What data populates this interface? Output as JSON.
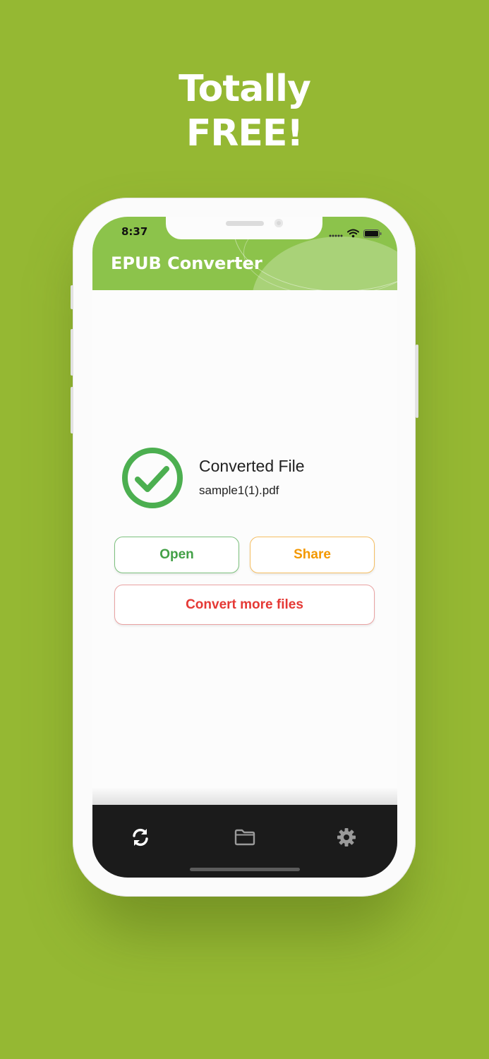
{
  "promo": {
    "line1": "Totally",
    "line2": "FREE!"
  },
  "status_bar": {
    "time": "8:37",
    "icons": [
      "signal-dots-icon",
      "wifi-icon",
      "battery-icon"
    ]
  },
  "header": {
    "title": "EPUB Converter"
  },
  "result": {
    "icon": "check-circle-icon",
    "title": "Converted File",
    "filename": "sample1(1).pdf"
  },
  "actions": {
    "open_label": "Open",
    "share_label": "Share",
    "convert_more_label": "Convert more files"
  },
  "tab_bar": {
    "items": [
      {
        "icon": "refresh-icon",
        "active": true
      },
      {
        "icon": "folder-icon",
        "active": false
      },
      {
        "icon": "gear-icon",
        "active": false
      }
    ]
  },
  "colors": {
    "background": "#95b833",
    "header": "#8cc34b",
    "success": "#43a047",
    "share": "#f39800",
    "convert": "#e53935",
    "tab_bar": "#1b1b1b"
  }
}
